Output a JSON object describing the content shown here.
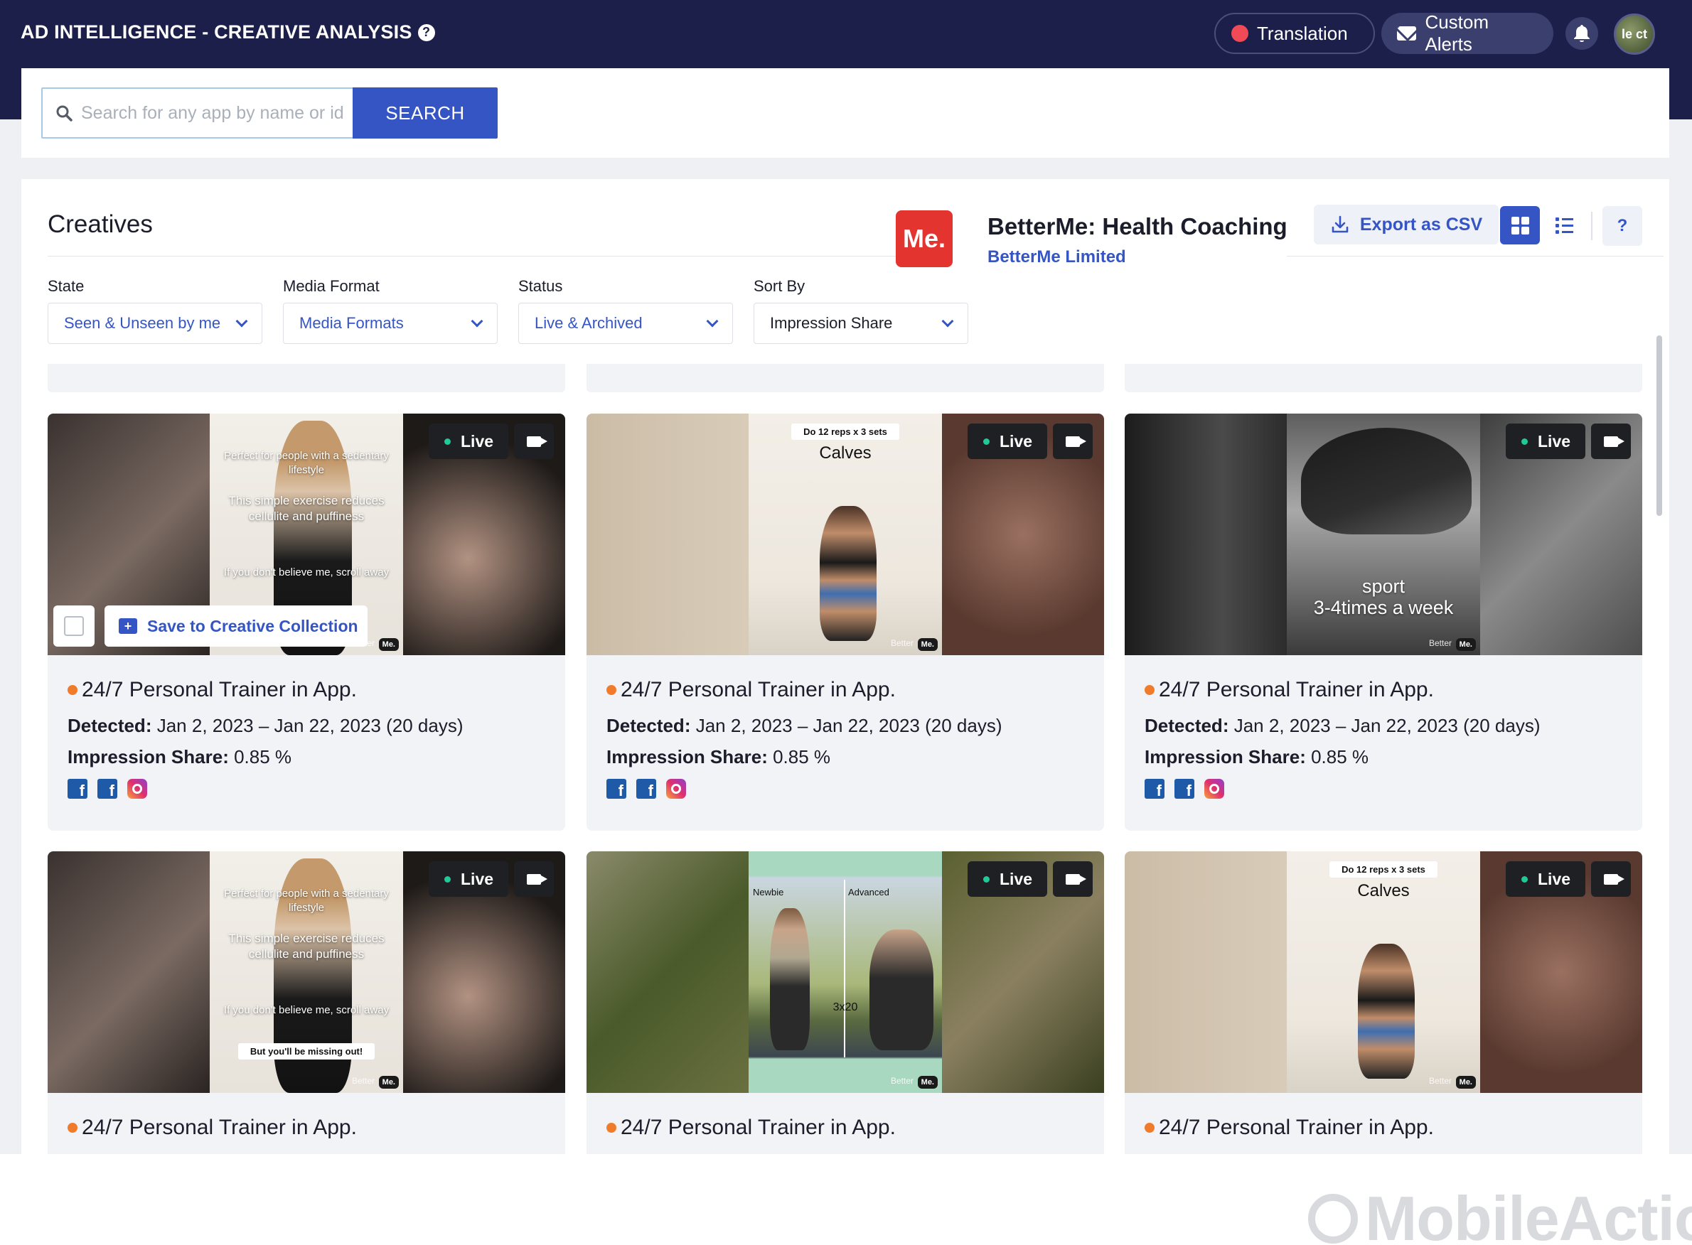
{
  "header": {
    "title": "AD INTELLIGENCE - CREATIVE ANALYSIS",
    "help_icon": "?",
    "translation_label": "Translation",
    "alerts_label": "Custom Alerts",
    "avatar_text": "le ct"
  },
  "search": {
    "placeholder": "Search for any app by name or id",
    "button_label": "SEARCH"
  },
  "creatives": {
    "title": "Creatives",
    "app": {
      "logo_text": "Me.",
      "name": "BetterMe: Health Coaching",
      "developer": "BetterMe Limited"
    },
    "export_label": "Export as CSV",
    "help_label": "?"
  },
  "filters": [
    {
      "label": "State",
      "value": "Seen & Unseen by me"
    },
    {
      "label": "Media Format",
      "value": "Media Formats"
    },
    {
      "label": "Status",
      "value": "Live & Archived"
    },
    {
      "label": "Sort By",
      "value": "Impression Share"
    }
  ],
  "card_common": {
    "live_label": "Live",
    "detected_label": "Detected:",
    "impression_label": "Impression Share:",
    "save_label": "Save to Creative Collection",
    "brand_badge": "Me.",
    "brand_text": "Better"
  },
  "cards": [
    {
      "title": "24/7 Personal Trainer in App.",
      "detected": "Jan 2, 2023 – Jan 22, 2023 (20 days)",
      "impression": "0.85 %",
      "frame_top": "Perfect for people with a sedentary lifestyle",
      "frame_mid": "This simple exercise reduces cellulite and puffiness",
      "frame_low": "If you don't believe me, scroll away"
    },
    {
      "title": "24/7 Personal Trainer in App.",
      "detected": "Jan 2, 2023 – Jan 22, 2023 (20 days)",
      "impression": "0.85 %",
      "tag": "Do 12 reps x 3 sets",
      "caption": "Calves"
    },
    {
      "title": "24/7 Personal Trainer in App.",
      "detected": "Jan 2, 2023 – Jan 22, 2023 (20 days)",
      "impression": "0.85 %",
      "caption_1": "sport",
      "caption_2": "3-4times a week"
    },
    {
      "title": "24/7 Personal Trainer in App.",
      "frame_top": "Perfect for people with a sedentary lifestyle",
      "frame_mid": "This simple exercise reduces cellulite and puffiness",
      "frame_low": "If you don't believe me, scroll away",
      "tag": "But you'll be missing out!"
    },
    {
      "title": "24/7 Personal Trainer in App.",
      "label_left": "Newbie",
      "label_right": "Advanced",
      "reps": "3x20"
    },
    {
      "title": "24/7 Personal Trainer in App.",
      "tag": "Do 12 reps x 3 sets",
      "caption": "Calves"
    }
  ],
  "watermark": "MobileAction",
  "colors": {
    "nav_bg": "#1c1f4a",
    "accent": "#3555c4",
    "live_dot": "#20c997",
    "status_dot": "#f07b2a",
    "app_logo": "#e3342f"
  }
}
